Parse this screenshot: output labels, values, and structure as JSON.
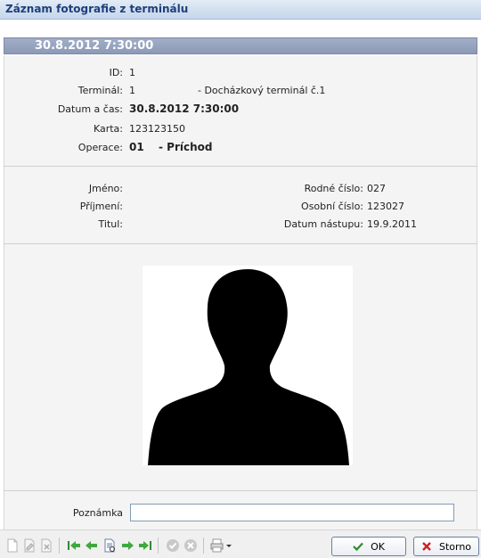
{
  "window": {
    "title": "Záznam fotografie z terminálu"
  },
  "header": {
    "datetime": "30.8.2012 7:30:00"
  },
  "record": {
    "id_label": "ID:",
    "id_value": "1",
    "terminal_label": "Terminál:",
    "terminal_value": "1",
    "terminal_name": "- Docházkový terminál č.1",
    "datetime_label": "Datum a čas:",
    "datetime_value": "30.8.2012 7:30:00",
    "card_label": "Karta:",
    "card_value": "123123150",
    "operation_label": "Operace:",
    "operation_code": "01",
    "operation_name": "- Príchod"
  },
  "person": {
    "first_name_label": "Jméno:",
    "first_name_value": "",
    "last_name_label": "Příjmení:",
    "last_name_value": "",
    "title_label": "Titul:",
    "title_value": "",
    "birth_number_label": "Rodné číslo:",
    "birth_number_value": "027",
    "personal_number_label": "Osobní číslo:",
    "personal_number_value": "123027",
    "start_date_label": "Datum nástupu:",
    "start_date_value": "19.9.2011"
  },
  "note": {
    "label": "Poznámka",
    "value": ""
  },
  "buttons": {
    "ok_label": "OK",
    "cancel_label": "Storno"
  },
  "icons": {
    "new": "new-doc-icon",
    "edit": "edit-doc-icon",
    "delete": "delete-doc-icon",
    "first": "first-record-icon",
    "prev": "prev-record-icon",
    "detail": "detail-icon",
    "next": "next-record-icon",
    "last": "last-record-icon",
    "confirm": "confirm-icon",
    "cancel": "cancel-icon",
    "print": "print-icon"
  },
  "colors": {
    "title_text": "#1e3f7a",
    "date_bar": "#8c9ab8",
    "accent_green": "#2e8b2e",
    "accent_red": "#cc2222"
  }
}
